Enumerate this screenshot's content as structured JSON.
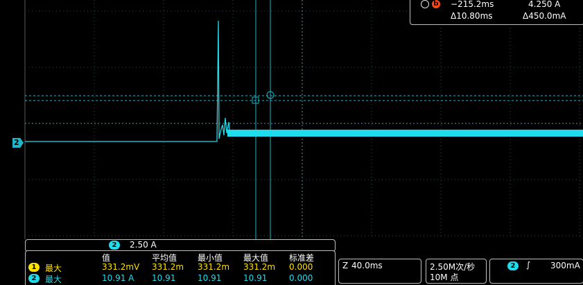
{
  "cursor_readout": {
    "row1_time": "−215.2ms",
    "row1_value": "4.250 A",
    "row2_delta_time": "Δ10.80ms",
    "row2_delta_value": "Δ450.0mA",
    "cursor_b_label": "b"
  },
  "channel_marker": {
    "label": "2"
  },
  "vertical_scale": {
    "channel": "2",
    "value": "2.50 A"
  },
  "measurements": {
    "headers": [
      "值",
      "平均值",
      "最小值",
      "最大值",
      "标准差"
    ],
    "rows": [
      {
        "channel": "1",
        "type": "最大",
        "values": [
          "331.2mV",
          "331.2m",
          "331.2m",
          "331.2m",
          "0.000"
        ],
        "color": "#ffe100"
      },
      {
        "channel": "2",
        "type": "最大",
        "values": [
          "10.91 A",
          "10.91",
          "10.91",
          "10.91",
          "0.000"
        ],
        "color": "#1fdcec"
      }
    ]
  },
  "horizontal": {
    "scale": "40.0ms"
  },
  "acquisition": {
    "rate": "2.50M次/秒",
    "points": "10M 点"
  },
  "trigger": {
    "channel": "2",
    "level": "300mA"
  },
  "colors": {
    "ch1": "#ffe100",
    "ch2": "#1fdcec",
    "grid": "#2f6f7f",
    "cursor": "#1fb7c8"
  }
}
